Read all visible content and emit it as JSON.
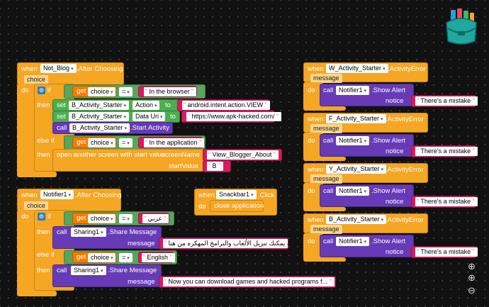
{
  "colors": {
    "event": "#f5a623",
    "control": "#58a55c",
    "setter": "#4caf50",
    "call": "#673ab7",
    "text": "#d81b60",
    "getter": "#f57c00"
  },
  "b1": {
    "when": "when",
    "component": "Not_Blog",
    "event": ".After Choosing",
    "param": "choice",
    "do": "do",
    "if": "if",
    "then": "then",
    "elseif": "else if",
    "then2": "then",
    "get": "get",
    "get_var": "choice",
    "eq": "=",
    "str1": "In the browser",
    "set": "set",
    "set_comp1": "B_Activity_Starter",
    "set_prop1": "Action",
    "to": "to",
    "action_val": "android.intent.action.VIEW",
    "set2": "set",
    "set_comp2": "B_Activity_Starter",
    "set_prop2": "Data Uri",
    "to2": "to",
    "uri_val": "https://www.apk-hacked.com/",
    "call": "call",
    "call_comp": "B_Activity_Starter",
    "call_method": ".Start Activity",
    "get2": "get",
    "get_var2": "choice",
    "eq2": "=",
    "str2": "In the application",
    "open_screen": "open another screen with start value",
    "screen_name_lbl": "screenName",
    "screen_name": "View_Blogger_About",
    "start_value_lbl": "startValue",
    "start_value": "B"
  },
  "b2": {
    "when": "when",
    "component": "Notifier1",
    "event": ".After Choosing",
    "param": "choice",
    "do": "do",
    "if": "if",
    "then": "then",
    "elseif": "else if",
    "then2": "then",
    "get": "get",
    "get_var": "choice",
    "eq": "=",
    "str1": "عربي",
    "call": "call",
    "call_comp": "Sharing1",
    "call_method": ".Share Message",
    "message_lbl": "message",
    "message_ar": "الآن يمكنك تنزيل الألعاب والبرامج المهكره من هنا ...",
    "get2": "get",
    "get_var2": "choice",
    "eq2": "=",
    "str2": "English",
    "call2": "call",
    "call_comp2": "Sharing1",
    "call_method2": ".Share Message",
    "message_lbl2": "message",
    "message_en": "Now you can download games and hacked programs f..."
  },
  "b3": {
    "when": "when",
    "component": "Snackbar1",
    "event": ".Click",
    "do": "do",
    "action": "close application"
  },
  "errors": [
    {
      "when": "when",
      "component": "W_Activity_Starter",
      "event": ".ActivityError",
      "param": "message",
      "do": "do",
      "call": "call",
      "notifier": "Notifier1",
      "method": ".Show Alert",
      "notice": "notice",
      "text": "There's a mistake"
    },
    {
      "when": "when",
      "component": "F_Activity_Starter",
      "event": ".ActivityError",
      "param": "message",
      "do": "do",
      "call": "call",
      "notifier": "Notifier1",
      "method": ".Show Alert",
      "notice": "notice",
      "text": "There's a mistake"
    },
    {
      "when": "when",
      "component": "Y_Activity_Starter",
      "event": ".ActivityError",
      "param": "message",
      "do": "do",
      "call": "call",
      "notifier": "Notifier1",
      "method": ".Show Alert",
      "notice": "notice",
      "text": "There's a mistake"
    },
    {
      "when": "when",
      "component": "B_Activity_Starter",
      "event": ".ActivityError",
      "param": "message",
      "do": "do",
      "call": "call",
      "notifier": "Notifier1",
      "method": ".Show Alert",
      "notice": "notice",
      "text": "There's a mistake"
    }
  ],
  "icons": {
    "backpack": "backpack-icon",
    "gear": "gear-icon",
    "zoom_in": "zoom-in-icon",
    "zoom_out": "zoom-out-icon",
    "center": "center-icon"
  }
}
